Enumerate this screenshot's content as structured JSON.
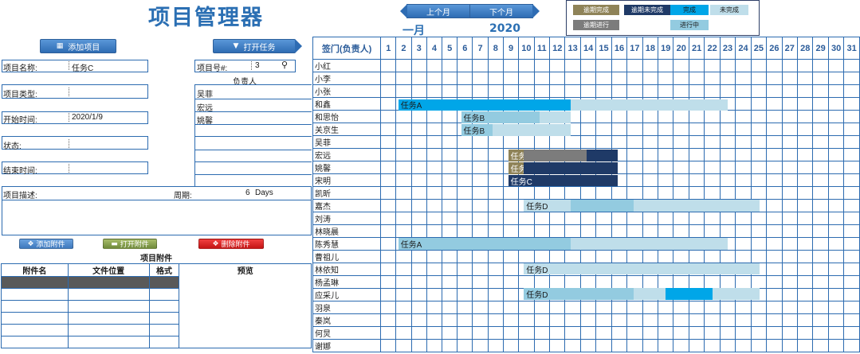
{
  "app": {
    "title": "项目管理器"
  },
  "toolbar": {
    "add_project": "添加项目",
    "open_task": "打开任务"
  },
  "form": {
    "project_name_label": "项目名称:",
    "project_name_value": "任务C",
    "project_number_label": "项目号#:",
    "project_number_value": "3",
    "project_type_label": "项目类型:",
    "owner_header": "负责人",
    "owners": [
      "吴菲",
      "宏远",
      "姚馨"
    ],
    "start_label": "开始时间:",
    "start_value": "2020/1/9",
    "status_label": "状态:",
    "end_label": "结束时间:",
    "desc_label": "项目描述:",
    "duration_label": "周期:",
    "duration_value": "6",
    "duration_unit": "Days"
  },
  "attachments": {
    "add_btn": "添加附件",
    "open_btn": "打开附件",
    "delete_btn": "删除附件",
    "title": "项目附件",
    "columns": [
      "附件名",
      "文件位置",
      "格式",
      "预览"
    ]
  },
  "calendar": {
    "prev_btn": "上个月",
    "next_btn": "下个月",
    "month": "一月",
    "year": "2020",
    "header_label": "签门(负责人)",
    "days": [
      "1",
      "2",
      "3",
      "4",
      "5",
      "6",
      "7",
      "8",
      "9",
      "10",
      "11",
      "12",
      "13",
      "14",
      "15",
      "16",
      "17",
      "18",
      "19",
      "20",
      "21",
      "22",
      "23",
      "24",
      "25",
      "26",
      "27",
      "28",
      "29",
      "30",
      "31"
    ]
  },
  "legend": {
    "items": [
      {
        "label": "逾期完成",
        "color": "#8f8358",
        "text_color": "#ffffff"
      },
      {
        "label": "逾期未完成",
        "color": "#1f3a67",
        "text_color": "#ffffff"
      },
      {
        "label": "完成",
        "color": "#00a6e8",
        "text_color": "#1a1a1a"
      },
      {
        "label": "未完成",
        "color": "#bfdeea",
        "text_color": "#1a1a1a"
      },
      {
        "label": "逾期进行",
        "color": "#7c7c7c",
        "text_color": "#ffffff"
      },
      {
        "label": "进行中",
        "color": "#93cbe0",
        "text_color": "#1a1a1a"
      }
    ]
  },
  "employees": [
    "小红",
    "小李",
    "小张",
    "和鑫",
    "和思怡",
    "关京生",
    "吴菲",
    "宏远",
    "姚馨",
    "宋明",
    "凯昕",
    "嘉杰",
    "刘涛",
    "林晓晨",
    "陈秀慧",
    "曹祖儿",
    "林依知",
    "杨孟琳",
    "应采儿",
    "羽泉",
    "秦岚",
    "何炅",
    "谢娜"
  ],
  "tasks": [
    {
      "label": "任务A",
      "row": 2,
      "segments": [
        {
          "start": 1,
          "end": 11,
          "state": "done"
        },
        {
          "start": 12,
          "end": 21,
          "state": "todo"
        }
      ]
    },
    {
      "label": "任务B",
      "row": 3,
      "segments": [
        {
          "start": 5,
          "end": 9,
          "state": "doing"
        },
        {
          "start": 10,
          "end": 11,
          "state": "todo"
        }
      ]
    },
    {
      "label": "任务B",
      "row": 4,
      "segments": [
        {
          "start": 5,
          "end": 6,
          "state": "doing"
        },
        {
          "start": 7,
          "end": 11,
          "state": "todo"
        }
      ]
    },
    {
      "label": "任务C",
      "row": 6,
      "segments": [
        {
          "start": 8,
          "end": 8,
          "state": "late_done"
        },
        {
          "start": 9,
          "end": 12,
          "state": "late_doing"
        },
        {
          "start": 13,
          "end": 14,
          "state": "late_todo"
        }
      ]
    },
    {
      "label": "任务C",
      "row": 7,
      "segments": [
        {
          "start": 8,
          "end": 8,
          "state": "late_done"
        },
        {
          "start": 9,
          "end": 14,
          "state": "late_todo"
        }
      ]
    },
    {
      "label": "任务C",
      "row": 8,
      "segments": [
        {
          "start": 8,
          "end": 14,
          "state": "late_todo"
        }
      ]
    },
    {
      "label": "任务D",
      "row": 10,
      "segments": [
        {
          "start": 9,
          "end": 11,
          "state": "todo"
        },
        {
          "start": 12,
          "end": 15,
          "state": "doing"
        },
        {
          "start": 16,
          "end": 23,
          "state": "todo"
        }
      ]
    },
    {
      "label": "任务A",
      "row": 13,
      "segments": [
        {
          "start": 1,
          "end": 11,
          "state": "doing"
        },
        {
          "start": 12,
          "end": 21,
          "state": "todo"
        }
      ]
    },
    {
      "label": "任务D",
      "row": 15,
      "segments": [
        {
          "start": 9,
          "end": 23,
          "state": "todo"
        }
      ]
    },
    {
      "label": "任务D",
      "row": 17,
      "segments": [
        {
          "start": 9,
          "end": 15,
          "state": "doing"
        },
        {
          "start": 16,
          "end": 17,
          "state": "todo"
        },
        {
          "start": 18,
          "end": 20,
          "state": "done"
        },
        {
          "start": 21,
          "end": 23,
          "state": "todo"
        }
      ]
    }
  ]
}
